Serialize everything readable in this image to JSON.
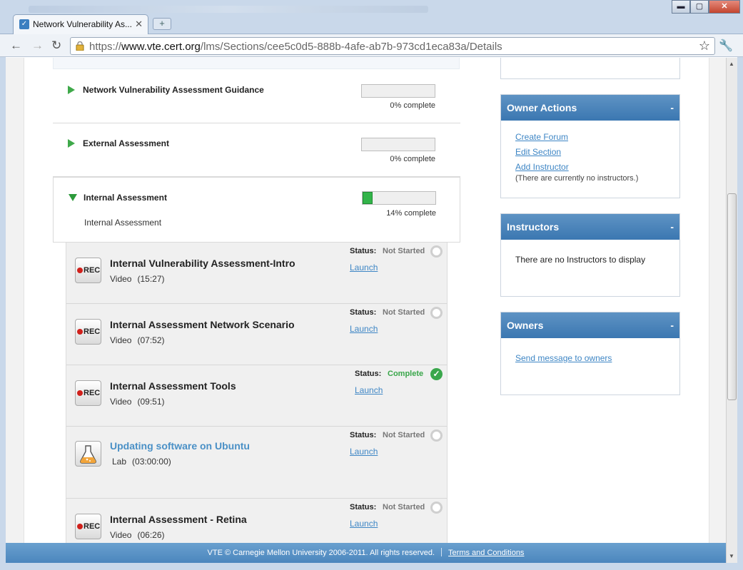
{
  "browser": {
    "tab_title": "Network Vulnerability As...",
    "tab_close": "✕",
    "new_tab": "+",
    "url_scheme": "https://",
    "url_host": "www.vte.cert.org",
    "url_path": "/lms/Sections/cee5c0d5-888b-4afe-ab7b-973cd1eca83a/Details",
    "win_min": "▬",
    "win_max": "▢",
    "win_close": "✕"
  },
  "modules": [
    {
      "title": "Network Vulnerability Assessment Guidance",
      "progress": 0,
      "progress_text": "0% complete",
      "expanded": false
    },
    {
      "title": "External Assessment",
      "progress": 0,
      "progress_text": "0% complete",
      "expanded": false
    },
    {
      "title": "Internal Assessment",
      "progress": 14,
      "progress_text": "14% complete",
      "expanded": true,
      "subtitle": "Internal Assessment"
    }
  ],
  "items": [
    {
      "title": "Internal Vulnerability Assessment-Intro",
      "type": "Video",
      "duration": "(15:27)",
      "status_label": "Status:",
      "status": "Not Started",
      "launch": "Launch",
      "icon": "rec-video-icon"
    },
    {
      "title": "Internal Assessment Network Scenario",
      "type": "Video",
      "duration": "(07:52)",
      "status_label": "Status:",
      "status": "Not Started",
      "launch": "Launch",
      "icon": "rec-video-icon"
    },
    {
      "title": "Internal Assessment Tools",
      "type": "Video",
      "duration": "(09:51)",
      "status_label": "Status:",
      "status": "Complete",
      "launch": "Launch",
      "icon": "rec-video-icon"
    },
    {
      "title": "Updating software on Ubuntu",
      "type": "Lab",
      "duration": "(03:00:00)",
      "status_label": "Status:",
      "status": "Not Started",
      "launch": "Launch",
      "icon": "lab-flask-icon"
    },
    {
      "title": "Internal Assessment - Retina",
      "type": "Video",
      "duration": "(06:26)",
      "status_label": "Status:",
      "status": "Not Started",
      "launch": "Launch",
      "icon": "rec-video-icon"
    }
  ],
  "rec_label": "REC",
  "sidebar": {
    "owner_actions": {
      "title": "Owner Actions",
      "toggle": "-",
      "links": [
        "Create Forum",
        "Edit Section",
        "Add Instructor"
      ],
      "note": "(There are currently no instructors.)"
    },
    "instructors": {
      "title": "Instructors",
      "toggle": "-",
      "text": "There are no Instructors to display"
    },
    "owners": {
      "title": "Owners",
      "toggle": "-",
      "link": "Send message to owners"
    }
  },
  "footer": {
    "copyright": "VTE © Carnegie Mellon University 2006-2011. All rights reserved.",
    "terms": "Terms and Conditions"
  },
  "colors": {
    "accent_blue": "#3b77b1",
    "complete_green": "#39a64a",
    "link_blue": "#3e86c5"
  }
}
